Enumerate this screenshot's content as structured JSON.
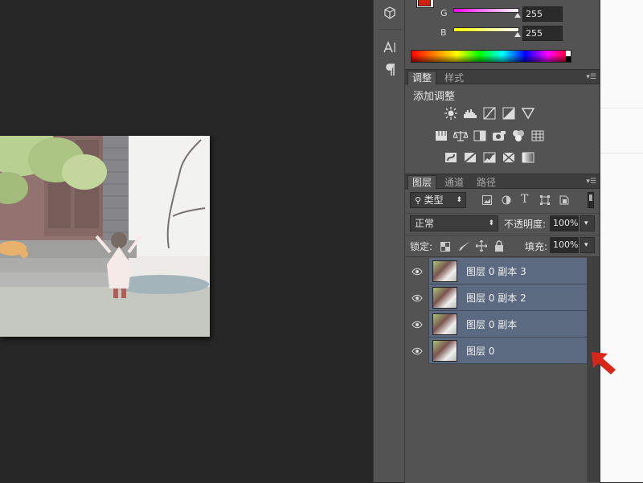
{
  "color_panel": {
    "g_label": "G",
    "b_label": "B",
    "g_value": "255",
    "b_value": "255",
    "foreground_color": "#d02010"
  },
  "adjustments_panel": {
    "tabs": [
      "调整",
      "样式"
    ],
    "title": "添加调整"
  },
  "layers_panel": {
    "tabs": [
      "图层",
      "通道",
      "路径"
    ],
    "filter_kind": "类型",
    "blend_mode": "正常",
    "opacity_label": "不透明度:",
    "opacity_value": "100%",
    "lock_label": "锁定:",
    "fill_label": "填充:",
    "fill_value": "100%",
    "layers": [
      {
        "name": "图层 0 副本 3"
      },
      {
        "name": "图层 0 副本 2"
      },
      {
        "name": "图层 0 副本"
      },
      {
        "name": "图层 0"
      }
    ]
  },
  "colors": {
    "selection": "#5b6a80",
    "annotation_arrow": "#d8261a"
  }
}
